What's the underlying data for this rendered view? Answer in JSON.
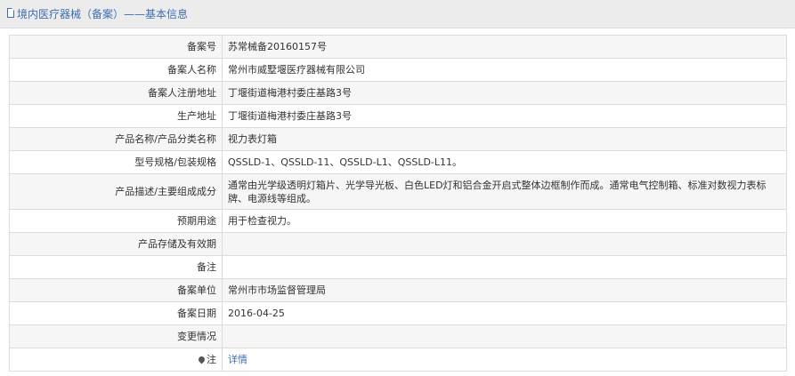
{
  "header": {
    "title": "境内医疗器械（备案）——基本信息"
  },
  "rows": [
    {
      "label": "备案号",
      "value": "苏常械备20160157号"
    },
    {
      "label": "备案人名称",
      "value": "常州市威墅堰医疗器械有限公司"
    },
    {
      "label": "备案人注册地址",
      "value": "丁堰街道梅港村委庄基路3号"
    },
    {
      "label": "生产地址",
      "value": "丁堰街道梅港村委庄基路3号"
    },
    {
      "label": "产品名称/产品分类名称",
      "value": "视力表灯箱"
    },
    {
      "label": "型号规格/包装规格",
      "value": "QSSLD-1、QSSLD-11、QSSLD-L1、QSSLD-L11。"
    },
    {
      "label": "产品描述/主要组成成分",
      "value": "通常由光学级透明灯箱片、光学导光板、白色LED灯和铝合金开启式整体边框制作而成。通常电气控制箱、标准对数视力表标牌、电源线等组成。"
    },
    {
      "label": "预期用途",
      "value": "用于检查视力。"
    },
    {
      "label": "产品存储及有效期",
      "value": ""
    },
    {
      "label": "备注",
      "value": ""
    },
    {
      "label": "备案单位",
      "value": "常州市市场监督管理局"
    },
    {
      "label": "备案日期",
      "value": "2016-04-25"
    },
    {
      "label": "变更情况",
      "value": ""
    },
    {
      "label": "注",
      "value": "详情"
    }
  ]
}
